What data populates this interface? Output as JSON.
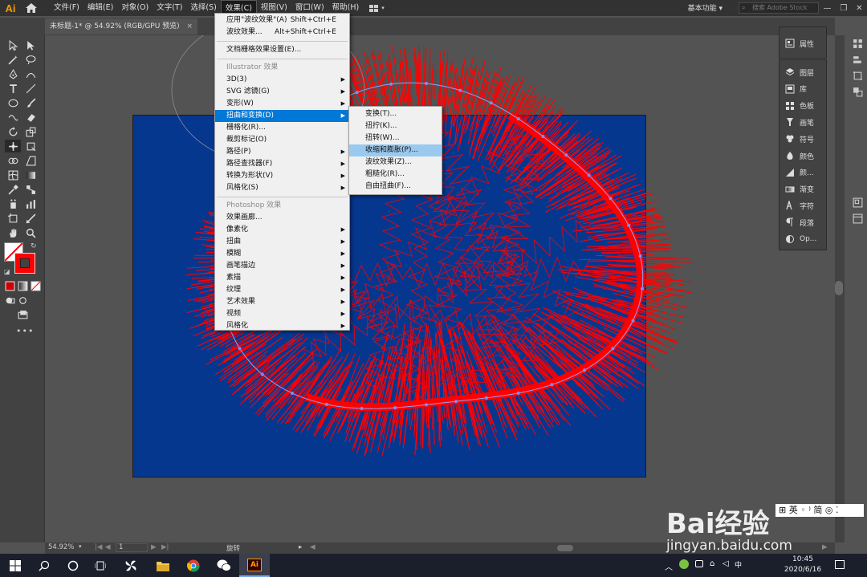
{
  "app": {
    "logo": "Ai",
    "workspace": "基本功能",
    "search_placeholder": "搜索 Adobe Stock"
  },
  "menubar": {
    "items": [
      "文件(F)",
      "编辑(E)",
      "对象(O)",
      "文字(T)",
      "选择(S)",
      "效果(C)",
      "视图(V)",
      "窗口(W)",
      "帮助(H)"
    ],
    "active_index": 5
  },
  "document": {
    "tab_title": "未标题-1* @ 54.92% (RGB/GPU 预览)",
    "close": "×"
  },
  "effect_menu": {
    "apply_last": "应用\"波纹效果\"(A)",
    "apply_last_sc": "Shift+Ctrl+E",
    "last": "波纹效果...",
    "last_sc": "Alt+Shift+Ctrl+E",
    "doc_raster": "文档栅格效果设置(E)...",
    "ill_header": "Illustrator 效果",
    "ill_items": [
      "3D(3)",
      "SVG 滤镜(G)",
      "变形(W)",
      "扭曲和变换(D)",
      "栅格化(R)...",
      "裁剪标记(O)",
      "路径(P)",
      "路径查找器(F)",
      "转换为形状(V)",
      "风格化(S)"
    ],
    "ps_header": "Photoshop 效果",
    "ps_items": [
      "效果画廊...",
      "像素化",
      "扭曲",
      "模糊",
      "画笔描边",
      "素描",
      "纹理",
      "艺术效果",
      "视频",
      "风格化"
    ]
  },
  "submenu": {
    "items": [
      "变换(T)...",
      "扭拧(K)...",
      "扭转(W)...",
      "收缩和膨胀(P)...",
      "波纹效果(Z)...",
      "粗糙化(R)...",
      "自由扭曲(F)..."
    ],
    "selected_index": 3
  },
  "panels": {
    "top": [
      "属性"
    ],
    "items": [
      "图层",
      "库",
      "色板",
      "画笔",
      "符号",
      "颜色",
      "颜...",
      "渐变",
      "字符",
      "段落",
      "Op..."
    ]
  },
  "status": {
    "zoom": "54.92%",
    "page": "1",
    "tool": "旋转"
  },
  "taskbar": {
    "time": "10:45",
    "date": "2020/6/16",
    "ime": "中"
  },
  "watermark": {
    "brand": "Bai经验",
    "url": "jingyan.baidu.com"
  },
  "colors": {
    "artboard": "#06378f",
    "stroke": "#ff0000",
    "menu_highlight": "#0078d7"
  }
}
